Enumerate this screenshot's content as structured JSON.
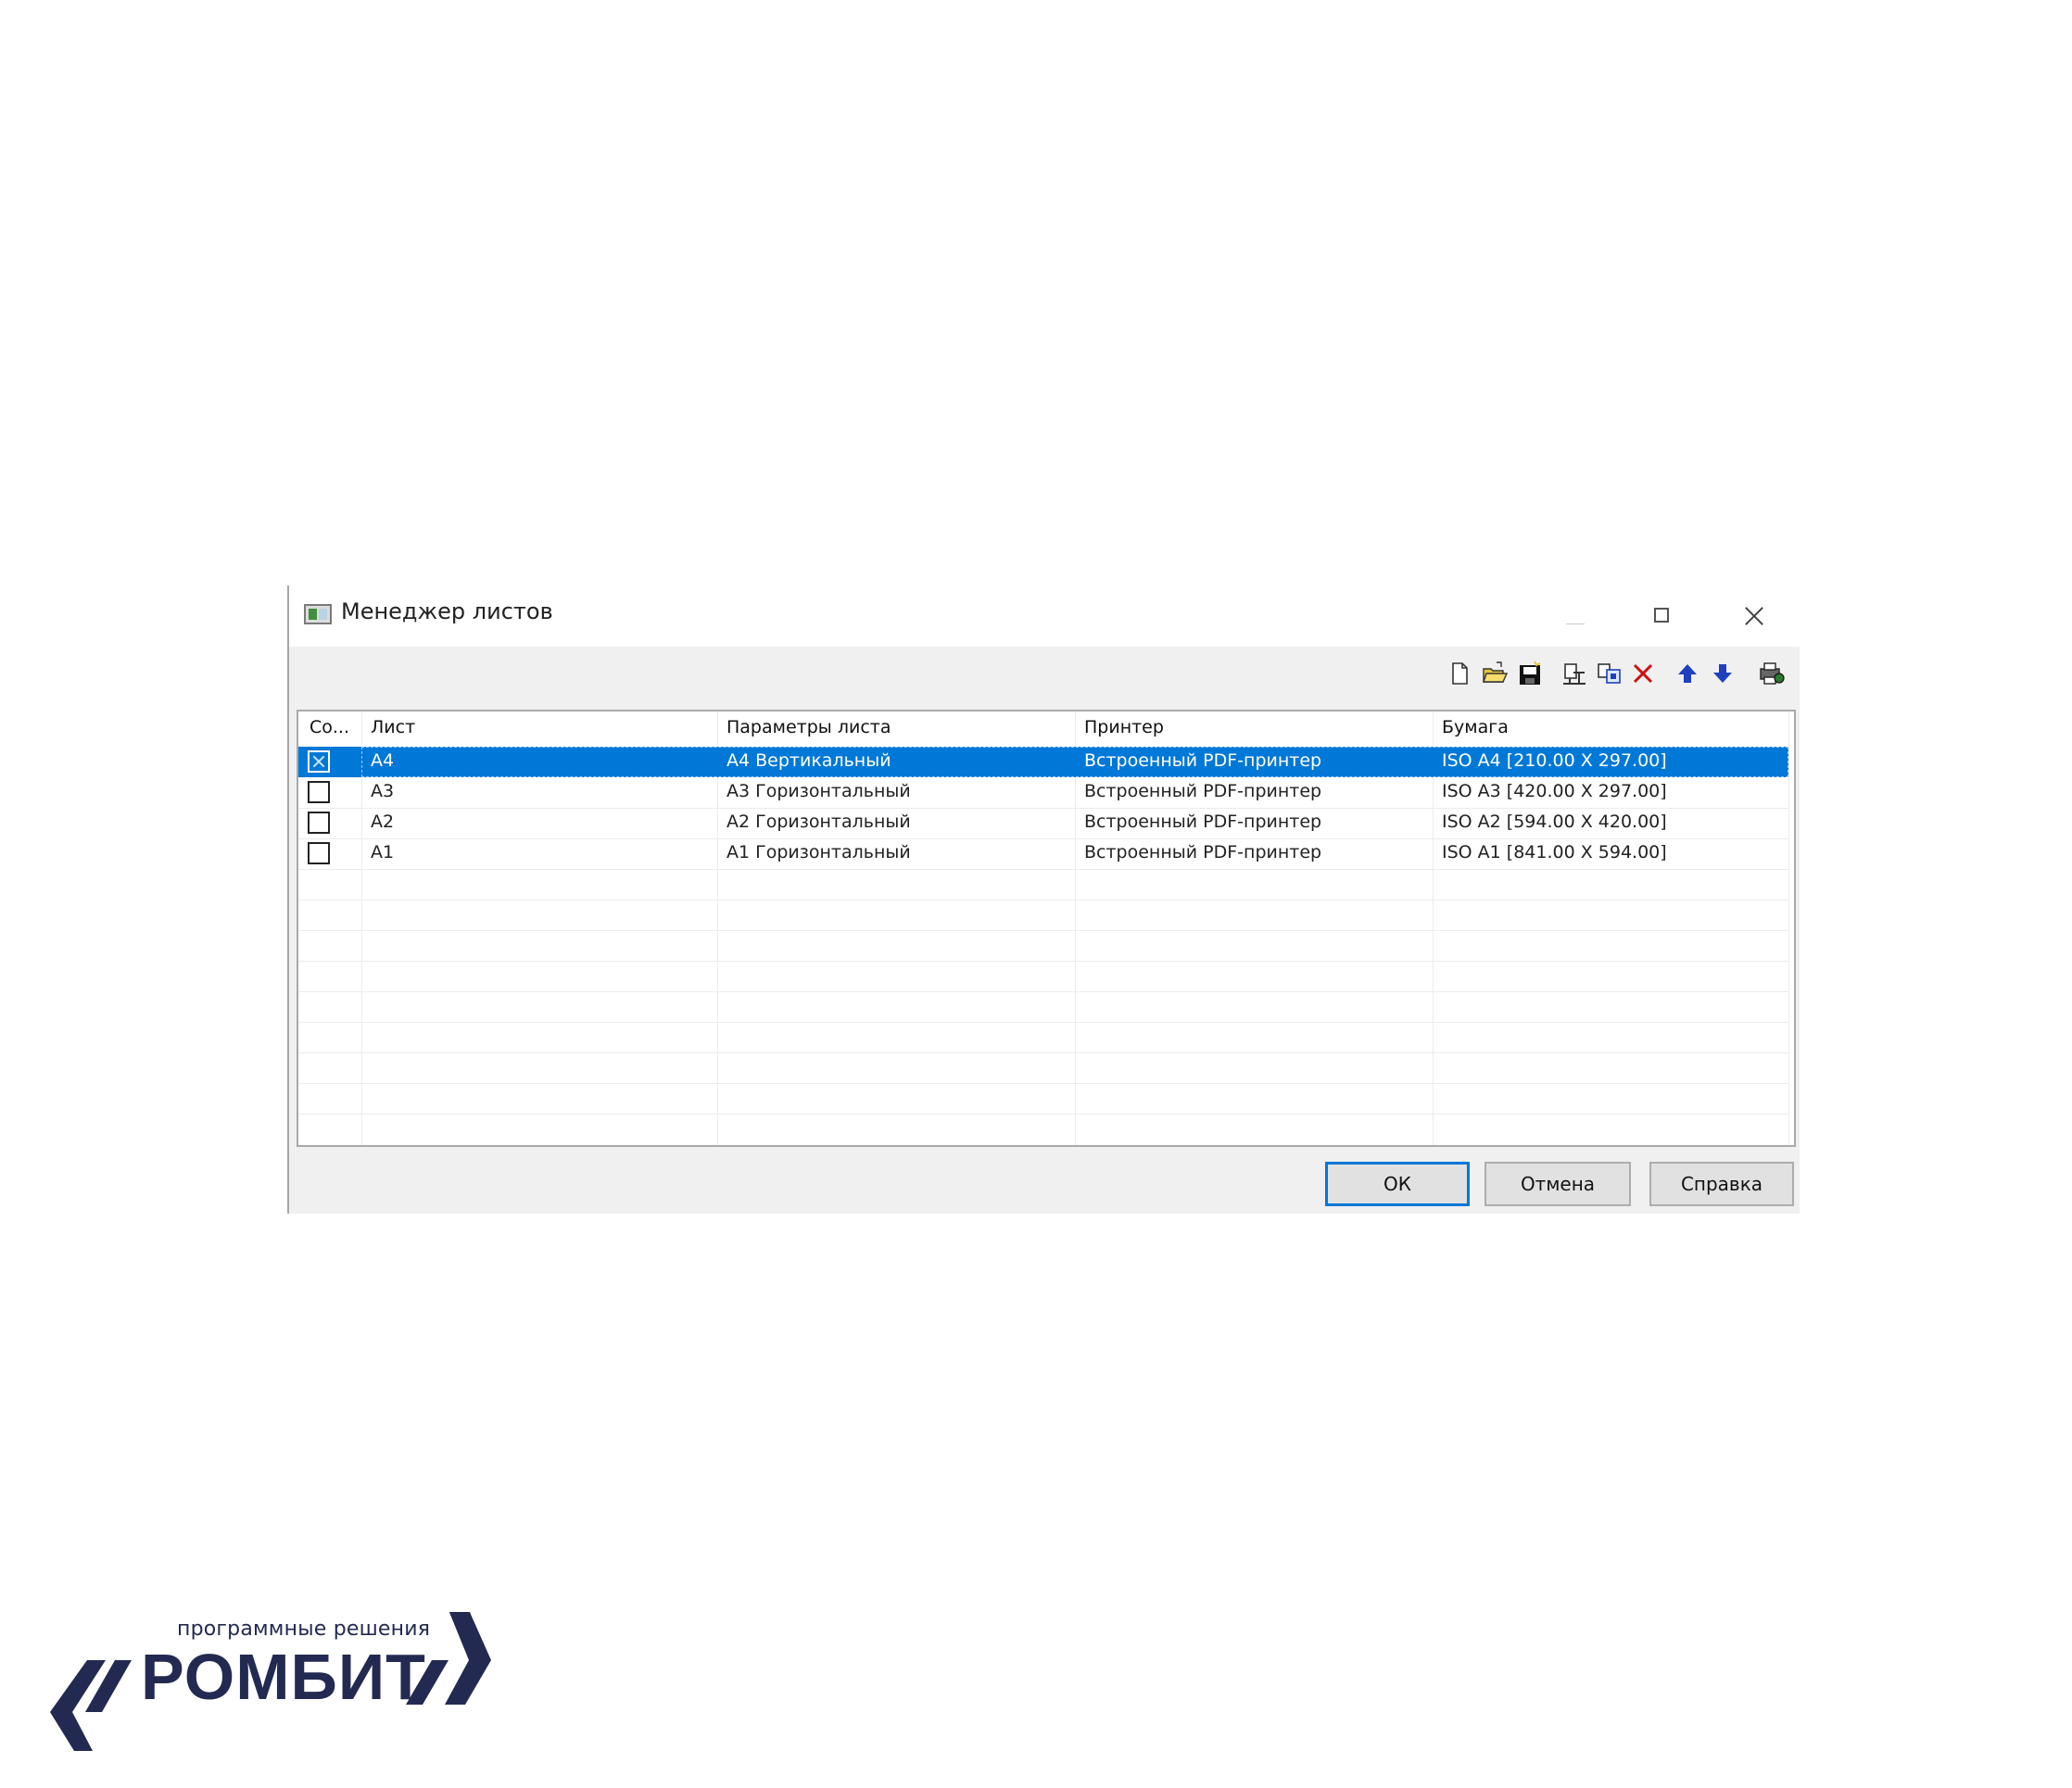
{
  "window": {
    "title": "Менеджер листов"
  },
  "toolbar": {
    "icons": [
      "new-icon",
      "open-folder-icon",
      "save-icon",
      "import-icon",
      "copy-icon",
      "delete-icon",
      "arrow-up-icon",
      "arrow-down-icon",
      "printer-settings-icon"
    ]
  },
  "table": {
    "columns": [
      "Со...",
      "Лист",
      "Параметры листа",
      "Принтер",
      "Бумага"
    ],
    "rows": [
      {
        "checked": true,
        "sheet": "А4",
        "params": "А4 Вертикальный",
        "printer": "Встроенный PDF-принтер",
        "paper": "ISO A4 [210.00 X 297.00]",
        "selected": true
      },
      {
        "checked": false,
        "sheet": "А3",
        "params": "А3 Горизонтальный",
        "printer": "Встроенный PDF-принтер",
        "paper": "ISO A3 [420.00 X 297.00]",
        "selected": false
      },
      {
        "checked": false,
        "sheet": "А2",
        "params": "А2 Горизонтальный",
        "printer": "Встроенный PDF-принтер",
        "paper": "ISO A2 [594.00 X 420.00]",
        "selected": false
      },
      {
        "checked": false,
        "sheet": "А1",
        "params": "А1 Горизонтальный",
        "printer": "Встроенный PDF-принтер",
        "paper": "ISO A1 [841.00 X 594.00]",
        "selected": false
      }
    ]
  },
  "buttons": {
    "ok": "ОК",
    "cancel": "Отмена",
    "help": "Справка"
  },
  "logo": {
    "tagline": "программные решения",
    "wordmark": "РОМБИТ"
  },
  "colors": {
    "selection": "#0078d7",
    "logo": "#232a52",
    "delete": "#d01010",
    "arrows": "#1f3fbf"
  }
}
